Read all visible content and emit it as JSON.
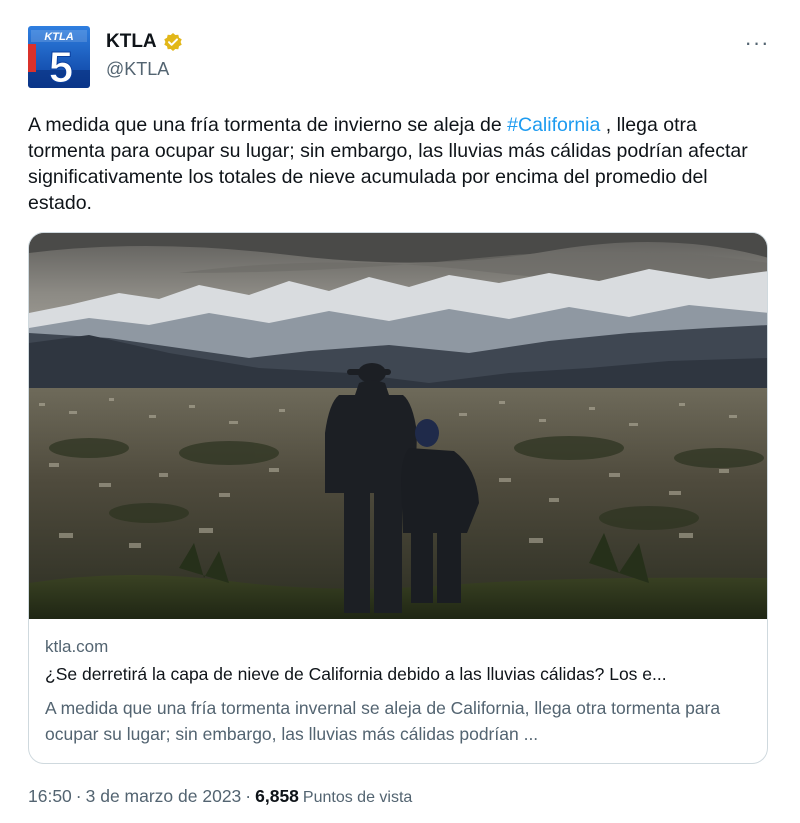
{
  "colors": {
    "link": "#1d9bf0",
    "text_primary": "#0f1419",
    "text_secondary": "#536471",
    "border": "#cfd9de",
    "verified_badge": "#e2b719"
  },
  "author": {
    "display_name": "KTLA",
    "handle": "@KTLA",
    "avatar_logo_text": "KTLA",
    "avatar_logo_number": "5",
    "verified_icon": "verified-badge-icon"
  },
  "tweet": {
    "text_before": "A medida que una fría tormenta de invierno se aleja de ",
    "hashtag": "#California",
    "text_after": " , llega otra tormenta para ocupar su lugar; sin embargo, las lluvias más cálidas podrían afectar significativamente los totales de nieve acumulada por encima del promedio del estado."
  },
  "card": {
    "domain": "ktla.com",
    "title": "¿Se derretirá la capa de nieve de California debido a las lluvias cálidas? Los e...",
    "description": "A medida que una fría tormenta invernal se aleja de California, llega otra tormenta para ocupar su lugar; sin embargo, las lluvias más cálidas podrían ...",
    "image_icon": "snowy-mountains-photo"
  },
  "meta": {
    "time": "16:50",
    "separator": "·",
    "date": "3 de marzo de 2023",
    "views_separator": "·",
    "views_count": "6,858",
    "views_label": "Puntos de vista"
  },
  "more_icon": "more-options-icon"
}
